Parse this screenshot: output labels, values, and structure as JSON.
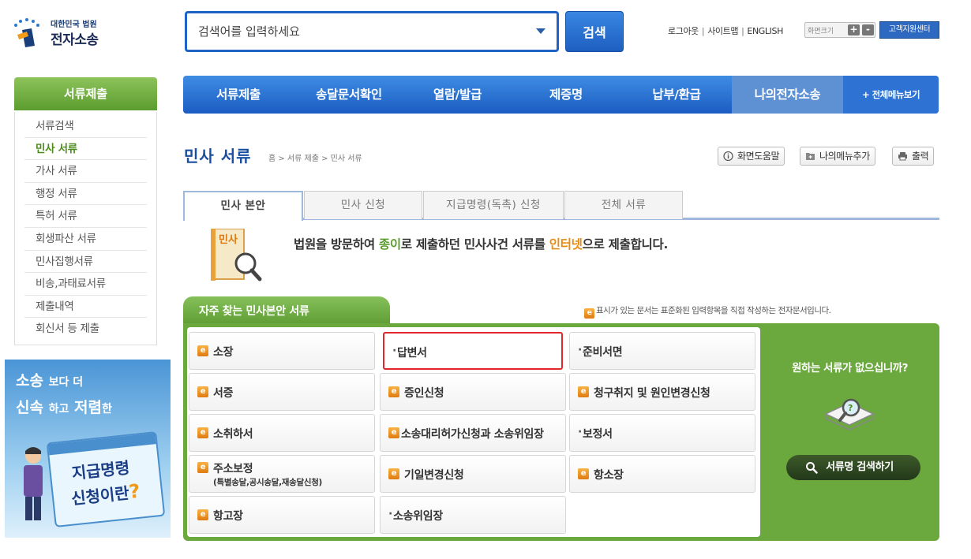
{
  "logo": {
    "sub": "대한민국 법원",
    "main": "전자소송"
  },
  "search": {
    "placeholder": "검색어를 입력하세요",
    "button": "검색"
  },
  "top_util": {
    "logout": "로그아웃",
    "sitemap": "사이트맵",
    "english": "ENGLISH",
    "font_size": "화면크기",
    "plus": "+",
    "minus": "-",
    "help_center": "고객지원센터"
  },
  "gnb": {
    "items": [
      {
        "label": "서류제출"
      },
      {
        "label": "송달문서확인"
      },
      {
        "label": "열람/발급"
      },
      {
        "label": "제증명"
      },
      {
        "label": "납부/환급"
      },
      {
        "label": "나의전자소송"
      }
    ],
    "all_menu": "+ 전체메뉴보기"
  },
  "sidebar": {
    "title": "서류제출",
    "items": [
      {
        "label": "서류검색"
      },
      {
        "label": "민사 서류"
      },
      {
        "label": "가사 서류"
      },
      {
        "label": "행정 서류"
      },
      {
        "label": "특허 서류"
      },
      {
        "label": "회생파산 서류"
      },
      {
        "label": "민사집행서류"
      },
      {
        "label": "비송,과태료서류"
      },
      {
        "label": "제출내역"
      },
      {
        "label": "회신서 등 제출"
      }
    ]
  },
  "promo": {
    "line1_a": "소송",
    "line1_b": "보다 더",
    "line2_a": "신속",
    "line2_b": "하고",
    "line2_c": "저렴",
    "line2_d": "한",
    "title1": "지급명령",
    "title2": "신청이란",
    "q": "?"
  },
  "page": {
    "title": "민사 서류",
    "breadcrumb": "홈 > 서류 제출 > 민사 서류",
    "tools": {
      "help": "화면도움말",
      "my_menu": "나의메뉴추가",
      "print": "출력"
    }
  },
  "tabs": [
    {
      "label": "민사 본안"
    },
    {
      "label": "민사 신청"
    },
    {
      "label": "지급명령(독촉) 신청"
    },
    {
      "label": "전체 서류"
    }
  ],
  "intro": {
    "icon_label": "민사",
    "text_a": "법원을 방문하여 ",
    "text_green": "종이",
    "text_b": "로 제출하던 민사사건 서류를 ",
    "text_orange": "인터넷",
    "text_c": "으로 제출합니다."
  },
  "freq": {
    "title": "자주 찾는 민사본안 서류",
    "note": "표시가 있는 문서는 표준화된 입력항목을 직접 작성하는 전자문서입니다.",
    "cells": {
      "c1": "소장",
      "c2": "답변서",
      "c3": "준비서면",
      "c4": "서증",
      "c5": "증인신청",
      "c6": "청구취지 및 원인변경신청",
      "c7": "소취하서",
      "c8": "소송대리허가신청과 소송위임장",
      "c9": "보정서",
      "c10": "주소보정",
      "c10_sub": "(특별송달,공시송달,재송달신청)",
      "c11": "기일변경신청",
      "c12": "항소장",
      "c13": "항고장",
      "c14": "소송위임장"
    },
    "bullet": "·",
    "e_icon": "e",
    "right": {
      "question": "원하는 서류가 없으십니까?",
      "search_button": "서류명 검색하기"
    }
  },
  "colors": {
    "brand_blue": "#1f63c4",
    "green": "#6ba83e",
    "orange": "#e88b12",
    "selected_border": "#e2262b"
  }
}
